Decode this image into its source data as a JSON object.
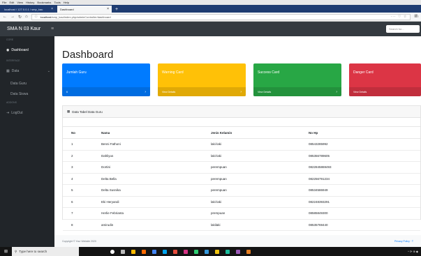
{
  "browser": {
    "menu": [
      "File",
      "Edit",
      "View",
      "History",
      "Bookmarks",
      "Tools",
      "Help"
    ],
    "tabs": [
      {
        "label": "localhost / 127.0.0.1 / smp_kau"
      },
      {
        "label": "Dashboard"
      }
    ],
    "url_host": "localhost",
    "url_path": "/smp_kau/index.php/adminController/dashboard",
    "url_actions": "··· ♡ ☆",
    "right_icon": "lll\\"
  },
  "app": {
    "brand": "SMA N 03 Kaur",
    "search_placeholder": "Search for..."
  },
  "sidebar": {
    "sections": [
      {
        "heading": "CORE"
      },
      {
        "heading": "INTERFACE"
      },
      {
        "heading": "ADDONS"
      }
    ],
    "items": {
      "dashboard": "Dashboard",
      "data": "Data",
      "data_guru": "Data Guru",
      "data_siswa": "Data Siswa",
      "logout": "LogOut"
    }
  },
  "main": {
    "title": "Dashboard",
    "cards": [
      {
        "title": "Jumlah Guru",
        "footer": "6",
        "color": "#007bff"
      },
      {
        "title": "Warning Card",
        "footer": "View Details",
        "color": "#ffc107"
      },
      {
        "title": "Success Card",
        "footer": "View Details",
        "color": "#28a745"
      },
      {
        "title": "Danger Card",
        "footer": "View Details",
        "color": "#dc3545"
      }
    ],
    "table_title": "Data Tabel Data Guru",
    "table": {
      "headers": [
        "No",
        "Nama",
        "Jenis Kelamin",
        "No Hp"
      ],
      "rows": [
        [
          "1",
          "Benni Fathoni",
          "laki-laki",
          "08543285992"
        ],
        [
          "2",
          "Dahliyus",
          "laki-laki",
          "085356789605"
        ],
        [
          "3",
          "Dortini",
          "perempuan",
          "0822845869493"
        ],
        [
          "4",
          "Delta Bella",
          "perempuan",
          "082256791234"
        ],
        [
          "5",
          "Delta Susnika",
          "perempuan",
          "08534586949"
        ],
        [
          "6",
          "Eki Heryandi",
          "laki-laki",
          "082248393291"
        ],
        [
          "7",
          "Herlie Febrianta",
          "prempuan",
          "08585849300"
        ],
        [
          "8",
          "amirudin",
          "lakilaki",
          "08535769440"
        ]
      ]
    },
    "footer_copyright": "Copyright © Your Website 2020",
    "footer_links": "Privacy Policy · T"
  },
  "taskbar": {
    "search_placeholder": "Type here to search",
    "tray": "^ ⟳ ⊕ ◆"
  }
}
